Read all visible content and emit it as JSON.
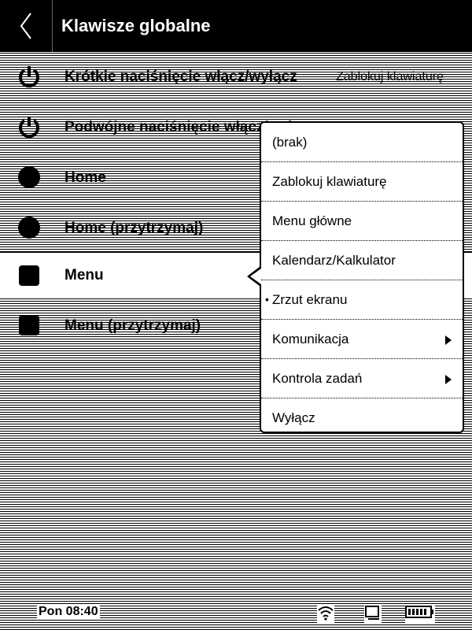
{
  "header": {
    "title": "Klawisze globalne",
    "back_icon": "chevron-left-icon"
  },
  "settings": [
    {
      "label": "Krótkie naciśnięcie włącz/wyłącz",
      "value": "Zablokuj klawiaturę",
      "icon": "power-icon"
    },
    {
      "label": "Podwójne naciśnięcie włącz/wyłącz",
      "value": "",
      "icon": "power-icon"
    },
    {
      "label": "Home",
      "value": "",
      "icon": "circle-icon"
    },
    {
      "label": "Home (przytrzymaj)",
      "value": "",
      "icon": "circle-icon"
    },
    {
      "label": "Menu",
      "value": "",
      "icon": "square-icon",
      "selected": true
    },
    {
      "label": "Menu (przytrzymaj)",
      "value": "",
      "icon": "square-icon"
    }
  ],
  "popup_menu": {
    "items": [
      {
        "label": "(brak)"
      },
      {
        "label": "Zablokuj klawiaturę"
      },
      {
        "label": "Menu główne"
      },
      {
        "label": "Kalendarz/Kalkulator"
      },
      {
        "label": "Zrzut ekranu",
        "bullet": "•",
        "selected": true
      },
      {
        "label": "Komunikacja",
        "submenu": true
      },
      {
        "label": "Kontrola zadań",
        "submenu": true
      },
      {
        "label": "Wyłącz"
      }
    ]
  },
  "status_bar": {
    "time": "Pon 08:40",
    "icons": [
      "wifi-icon",
      "tablet-icon",
      "battery-icon"
    ]
  }
}
